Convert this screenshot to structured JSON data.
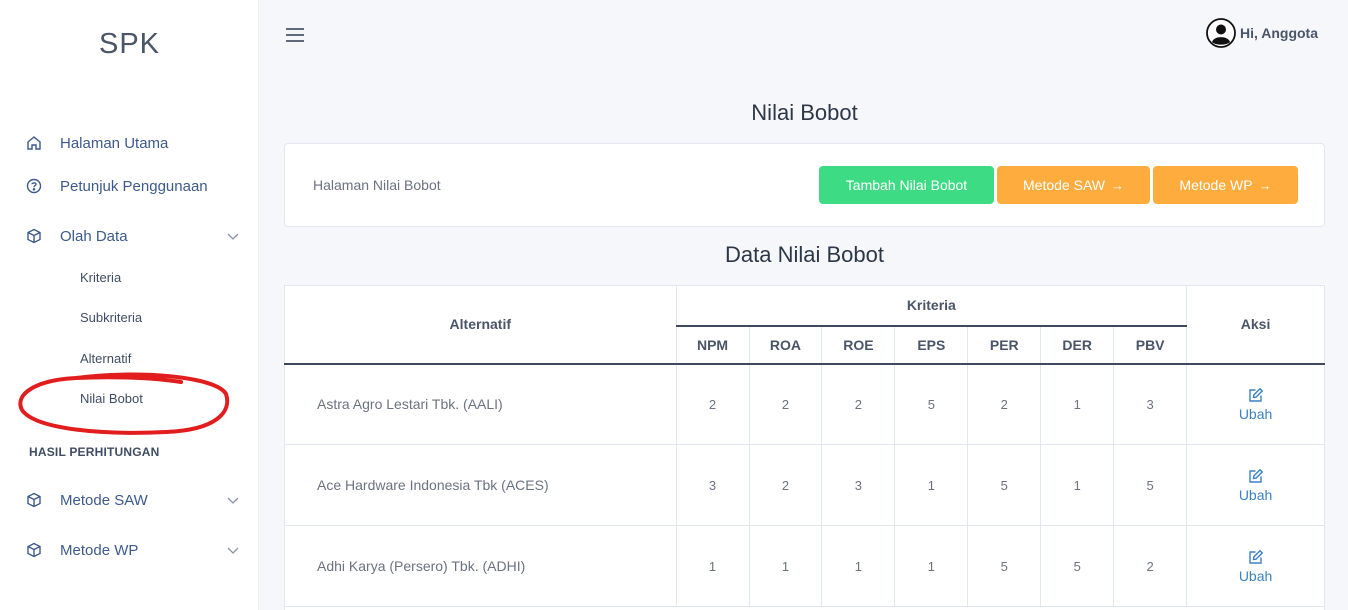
{
  "sidebar": {
    "brand": "SPK",
    "items": [
      {
        "label": "Halaman Utama",
        "icon": "home-icon"
      },
      {
        "label": "Petunjuk Penggunaan",
        "icon": "help-circle-icon"
      },
      {
        "label": "Olah Data",
        "icon": "box-icon"
      }
    ],
    "olah_data_sub": [
      "Kriteria",
      "Subkriteria",
      "Alternatif",
      "Nilai Bobot"
    ],
    "section_label": "HASIL PERHITUNGAN",
    "hasil_items": [
      {
        "label": "Metode SAW",
        "icon": "box-icon"
      },
      {
        "label": "Metode WP",
        "icon": "box-icon"
      }
    ]
  },
  "header": {
    "user_greeting": "Hi, Anggota"
  },
  "page": {
    "title": "Nilai Bobot",
    "card_text": "Halaman Nilai Bobot",
    "buttons": {
      "add": "Tambah Nilai Bobot",
      "saw": "Metode SAW",
      "wp": "Metode WP"
    },
    "section_title": "Data Nilai Bobot"
  },
  "table": {
    "col_alternatif": "Alternatif",
    "col_kriteria": "Kriteria",
    "col_aksi": "Aksi",
    "criteria": [
      "NPM",
      "ROA",
      "ROE",
      "EPS",
      "PER",
      "DER",
      "PBV"
    ],
    "action_label": "Ubah",
    "rows": [
      {
        "name": "Astra Agro Lestari Tbk. (AALI)",
        "values": [
          "2",
          "2",
          "2",
          "5",
          "2",
          "1",
          "3"
        ]
      },
      {
        "name": "Ace Hardware Indonesia Tbk (ACES)",
        "values": [
          "3",
          "2",
          "3",
          "1",
          "5",
          "1",
          "5"
        ]
      },
      {
        "name": "Adhi Karya (Persero) Tbk. (ADHI)",
        "values": [
          "1",
          "1",
          "1",
          "1",
          "5",
          "5",
          "2"
        ]
      }
    ]
  },
  "colors": {
    "green_button": "#3ddc84",
    "orange_button": "#ffac3f",
    "link_blue": "#3b82c4",
    "annotation_red": "#e11d1d"
  }
}
